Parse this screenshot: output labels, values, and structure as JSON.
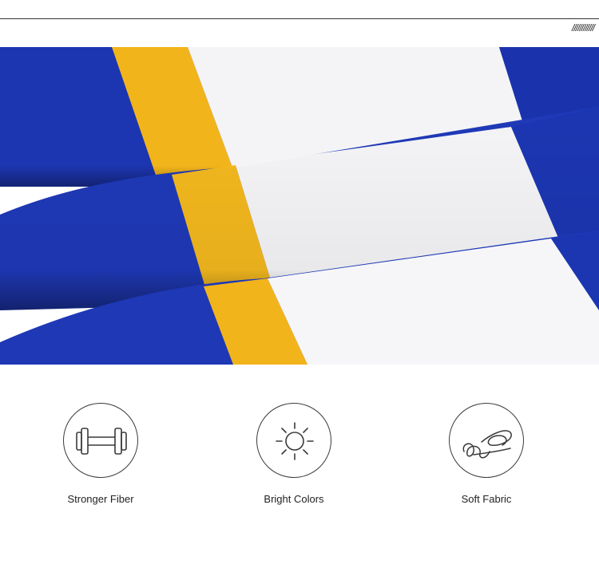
{
  "header": {
    "decoration": "////////////"
  },
  "photo": {
    "subject": "folded striped fabric",
    "colors": {
      "blue": "#1c35b0",
      "yellow": "#f2b41b",
      "white": "#f4f4f6"
    }
  },
  "features": [
    {
      "icon": "dumbbell-icon",
      "label": "Stronger Fiber"
    },
    {
      "icon": "sun-icon",
      "label": "Bright Colors"
    },
    {
      "icon": "scribble-icon",
      "label": "Soft Fabric"
    }
  ]
}
